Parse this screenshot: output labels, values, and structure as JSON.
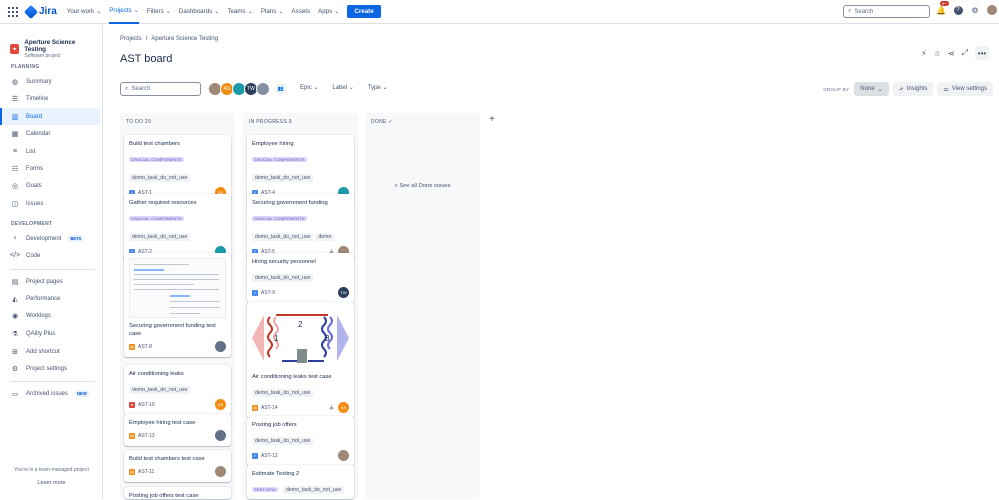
{
  "topnav": {
    "logo": "Jira",
    "items": [
      {
        "label": "Your work",
        "active": false
      },
      {
        "label": "Projects",
        "active": true
      },
      {
        "label": "Filters",
        "active": false
      },
      {
        "label": "Dashboards",
        "active": false
      },
      {
        "label": "Teams",
        "active": false
      },
      {
        "label": "Plans",
        "active": false
      },
      {
        "label": "Assets",
        "active": false
      },
      {
        "label": "Apps",
        "active": false
      }
    ],
    "create": "Create",
    "search_placeholder": "Search",
    "notif_count": "9+"
  },
  "sidebar": {
    "project_name": "Aperture Science Testing",
    "project_type": "Software project",
    "planning_label": "PLANNING",
    "planning": [
      {
        "label": "Summary",
        "icon": "globe-icon"
      },
      {
        "label": "Timeline",
        "icon": "timeline-icon"
      },
      {
        "label": "Board",
        "icon": "board-icon",
        "active": true
      },
      {
        "label": "Calendar",
        "icon": "calendar-icon"
      },
      {
        "label": "List",
        "icon": "list-icon"
      },
      {
        "label": "Forms",
        "icon": "forms-icon"
      },
      {
        "label": "Goals",
        "icon": "goals-icon"
      },
      {
        "label": "Issues",
        "icon": "issues-icon"
      }
    ],
    "development_label": "DEVELOPMENT",
    "development": [
      {
        "label": "Development",
        "badge": "BETA"
      },
      {
        "label": "Code"
      }
    ],
    "other": [
      {
        "label": "Project pages"
      },
      {
        "label": "Performance"
      },
      {
        "label": "Worklogs"
      },
      {
        "label": "QAlity Plus"
      },
      {
        "label": "Add shortcut"
      },
      {
        "label": "Project settings"
      }
    ],
    "archived": {
      "label": "Archived issues",
      "badge": "NEW"
    },
    "footer_text": "You're in a team-managed project",
    "footer_link": "Learn more"
  },
  "main": {
    "breadcrumb": [
      "Projects",
      "/",
      "Aperture Science Testing"
    ],
    "title": "AST board",
    "search_placeholder": "Search",
    "avatars": [
      {
        "initials": "",
        "color": "#a08876"
      },
      {
        "initials": "AS",
        "color": "#f18d13"
      },
      {
        "initials": "",
        "color": "#1d9aaa"
      },
      {
        "initials": "TW",
        "color": "#2c3e5d"
      },
      {
        "initials": "",
        "color": "#8590a2"
      }
    ],
    "filters": [
      "Epic",
      "Label",
      "Type"
    ],
    "group_by_label": "GROUP BY",
    "group_by_value": "None",
    "insights": "Insights",
    "view_settings": "View settings"
  },
  "columns": [
    {
      "title": "TO DO 29",
      "cards": [
        {
          "title": "Build test chambers",
          "epic": "CRUCIAL COMPONENTS",
          "tags": [
            "demo_task_do_not_use"
          ],
          "type": "task",
          "key": "AST-1",
          "assignee": "AS",
          "assignee_color": "#f18d13"
        },
        {
          "title": "Gather required resources",
          "epic": "CRUCIAL COMPONENTS",
          "tags": [
            "demo_task_do_not_use"
          ],
          "type": "task",
          "key": "AST-2",
          "assignee": "",
          "assignee_color": "#1d9aaa"
        },
        {
          "title": "Securing government funding test case",
          "type": "test",
          "key": "AST-8",
          "assignee": "",
          "assignee_color": "#626f86",
          "thumb": true
        },
        {
          "title": "Air conditioning leaks",
          "tags": [
            "demo_task_do_not_use"
          ],
          "type": "bug",
          "key": "AST-10",
          "assignee": "AS",
          "assignee_color": "#f18d13"
        },
        {
          "title": "Employee hiring test case",
          "type": "test",
          "key": "AST-13",
          "assignee": "",
          "assignee_color": "#626f86"
        },
        {
          "title": "Build test chambers test case",
          "type": "test",
          "key": "AST-11",
          "assignee": "",
          "assignee_color": "#a08876"
        },
        {
          "title": "Posting job offers test case"
        }
      ]
    },
    {
      "title": "IN PROGRESS 9",
      "cards": [
        {
          "title": "Employee hiring",
          "epic": "CRUCIAL COMPONENTS",
          "tags": [
            "demo_task_do_not_use"
          ],
          "type": "task",
          "key": "AST-4",
          "assignee": "",
          "assignee_color": "#1d9aaa"
        },
        {
          "title": "Securing government funding",
          "epic": "CRUCIAL COMPONENTS",
          "tags": [
            "demo_task_do_not_use",
            "demo"
          ],
          "type": "task",
          "key": "AST-5",
          "assignee": "",
          "assignee_color": "#a08876"
        },
        {
          "title": "Hiring security personnel",
          "tags": [
            "demo_task_do_not_use"
          ],
          "type": "task",
          "key": "AST-9",
          "assignee": "TW",
          "assignee_color": "#2c3e5d"
        },
        {
          "title": "Air conditioning leaks test case",
          "tags": [
            "demo_task_do_not_use"
          ],
          "type": "test",
          "key": "AST-14",
          "assignee": "AS",
          "assignee_color": "#f18d13",
          "diagram": [
            "1",
            "2",
            "3"
          ]
        },
        {
          "title": "Posting job offers",
          "tags": [
            "demo_task_do_not_use"
          ],
          "type": "task",
          "key": "AST-12",
          "assignee": "",
          "assignee_color": "#a08876"
        },
        {
          "title": "Estimate Testing 2",
          "epic": "TEST EPIC",
          "tags": [
            "demo_task_do_not_use"
          ]
        }
      ]
    },
    {
      "title": "DONE",
      "done_link": "See all Done issues"
    }
  ]
}
